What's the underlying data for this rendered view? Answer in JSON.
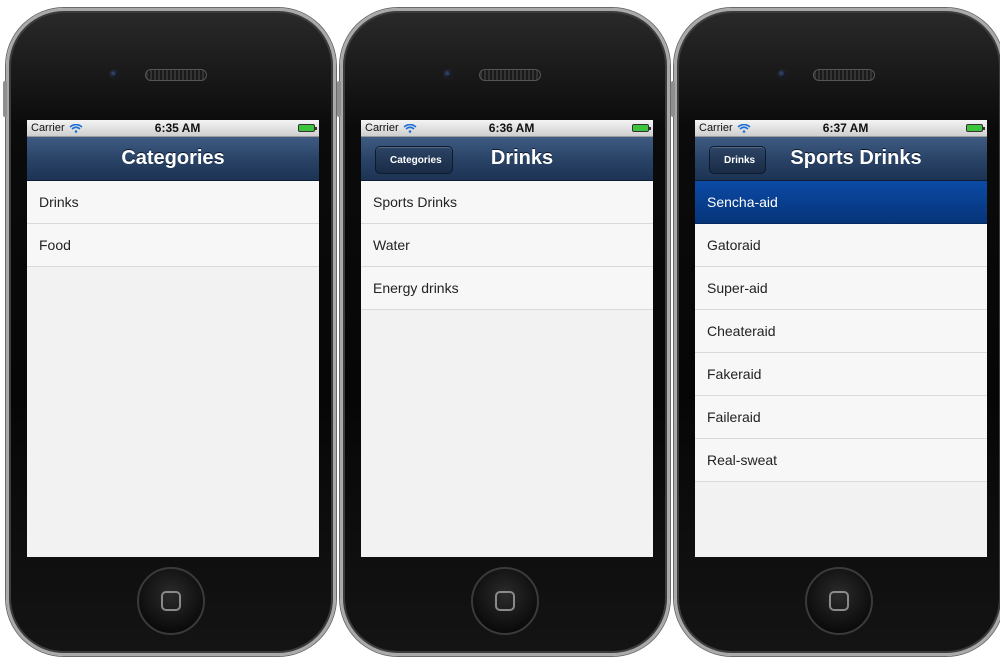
{
  "phones": [
    {
      "status": {
        "carrier": "Carrier",
        "time": "6:35 AM"
      },
      "nav": {
        "title": "Categories",
        "back": ""
      },
      "items": [
        "Drinks",
        "Food"
      ],
      "selected_index": -1
    },
    {
      "status": {
        "carrier": "Carrier",
        "time": "6:36 AM"
      },
      "nav": {
        "title": "Drinks",
        "back": "Categories"
      },
      "items": [
        "Sports Drinks",
        "Water",
        "Energy drinks"
      ],
      "selected_index": -1
    },
    {
      "status": {
        "carrier": "Carrier",
        "time": "6:37 AM"
      },
      "nav": {
        "title": "Sports Drinks",
        "back": "Drinks"
      },
      "items": [
        "Sencha-aid",
        "Gatoraid",
        "Super-aid",
        "Cheateraid",
        "Fakeraid",
        "Faileraid",
        "Real-sweat"
      ],
      "selected_index": 0
    }
  ],
  "colors": {
    "navbar": "#2a4468",
    "selected_row": "#0b4aa6",
    "list_background": "#f2f2f2"
  },
  "icons": [
    "wifi-icon",
    "battery-icon",
    "chevron-left-icon",
    "home-button-icon"
  ]
}
